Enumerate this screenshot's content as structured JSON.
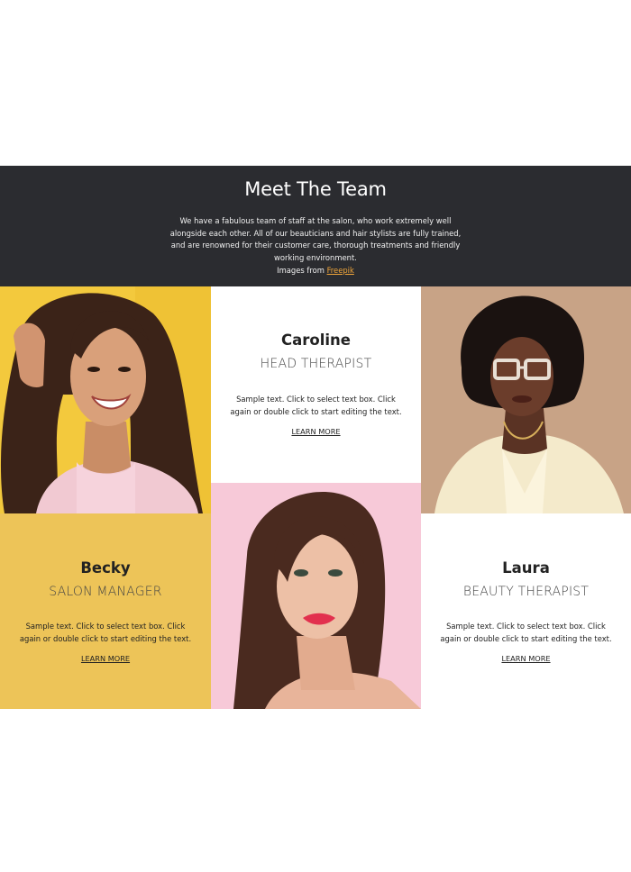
{
  "header": {
    "title": "Meet The Team",
    "description": "We have a fabulous team of staff at the salon, who work extremely well alongside each other. All of our beauticians and hair stylists are fully trained, and are renowned for their customer care, thorough treatments and friendly working environment.",
    "credit_prefix": "Images from ",
    "credit_link": "Freepik"
  },
  "team": [
    {
      "name": "Caroline",
      "role": "HEAD THERAPIST",
      "body": "Sample text. Click to select text box. Click again or double click to start editing the text.",
      "link": "LEARN MORE"
    },
    {
      "name": "Becky",
      "role": "SALON MANAGER",
      "body": "Sample text. Click to select text box. Click again or double click to start editing the text.",
      "link": "LEARN MORE"
    },
    {
      "name": "Laura",
      "role": "BEAUTY THERAPIST",
      "body": "Sample text. Click to select text box. Click again or double click to start editing the text.",
      "link": "LEARN MORE"
    }
  ],
  "colors": {
    "header_bg": "#2b2c30",
    "accent_yellow": "#edc458",
    "link_orange": "#f0a63a",
    "pink_bg": "#f7c9d8"
  }
}
